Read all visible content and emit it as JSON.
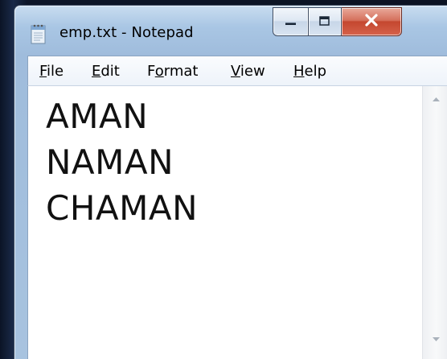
{
  "window": {
    "title": "emp.txt - Notepad",
    "app_icon": "notepad-icon",
    "caption_buttons": {
      "minimize_icon": "minimize-icon",
      "maximize_icon": "maximize-icon",
      "close_icon": "close-icon"
    }
  },
  "menu": {
    "items": [
      {
        "label_first": "F",
        "label_rest": "ile"
      },
      {
        "label_first": "E",
        "label_rest": "dit"
      },
      {
        "label_pre": "F",
        "label_first": "o",
        "label_rest": "rmat"
      },
      {
        "label_first": "V",
        "label_rest": "iew"
      },
      {
        "label_first": "H",
        "label_rest": "elp"
      }
    ]
  },
  "document": {
    "lines": [
      "AMAN",
      "NAMAN",
      "CHAMAN"
    ]
  },
  "scrollbar": {
    "up_icon": "scroll-up-arrow-icon",
    "down_icon": "scroll-down-arrow-icon"
  },
  "colors": {
    "close_button": "#c4472f",
    "title_bar": "#a9c6e4",
    "editor_background": "#ffffff",
    "text": "#111111"
  }
}
